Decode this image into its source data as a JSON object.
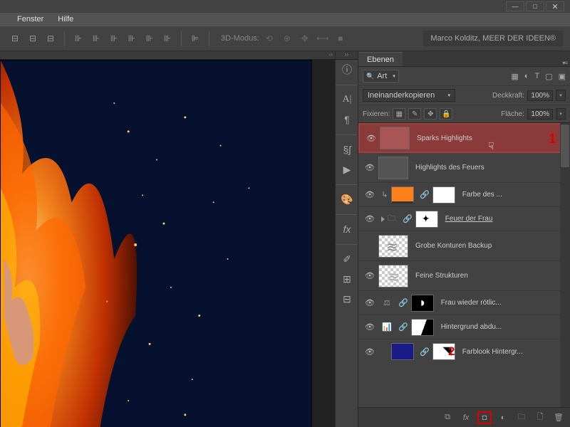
{
  "menu": {
    "fenster": "Fenster",
    "hilfe": "Hilfe"
  },
  "toolbar": {
    "mode3d": "3D-Modus:",
    "brand": "Marco Kolditz, MEER DER IDEEN®"
  },
  "panel": {
    "tab": "Ebenen",
    "filter_label": "Art",
    "blend_mode": "Ineinanderkopieren",
    "opacity_label": "Deckkraft:",
    "opacity_value": "100%",
    "lock_label": "Fixieren:",
    "fill_label": "Fläche:",
    "fill_value": "100%"
  },
  "layers": [
    {
      "name": "Sparks Highlights"
    },
    {
      "name": "Highlights des Feuers"
    },
    {
      "name": "Farbe des ..."
    },
    {
      "name": "Feuer der Frau"
    },
    {
      "name": "Grobe Konturen Backup"
    },
    {
      "name": "Feine Strukturen"
    },
    {
      "name": "Frau wieder rötlic..."
    },
    {
      "name": "Hintergrund abdu..."
    },
    {
      "name": "Farblook Hintergr..."
    }
  ],
  "annotations": {
    "a1": "1",
    "a2": "2"
  }
}
